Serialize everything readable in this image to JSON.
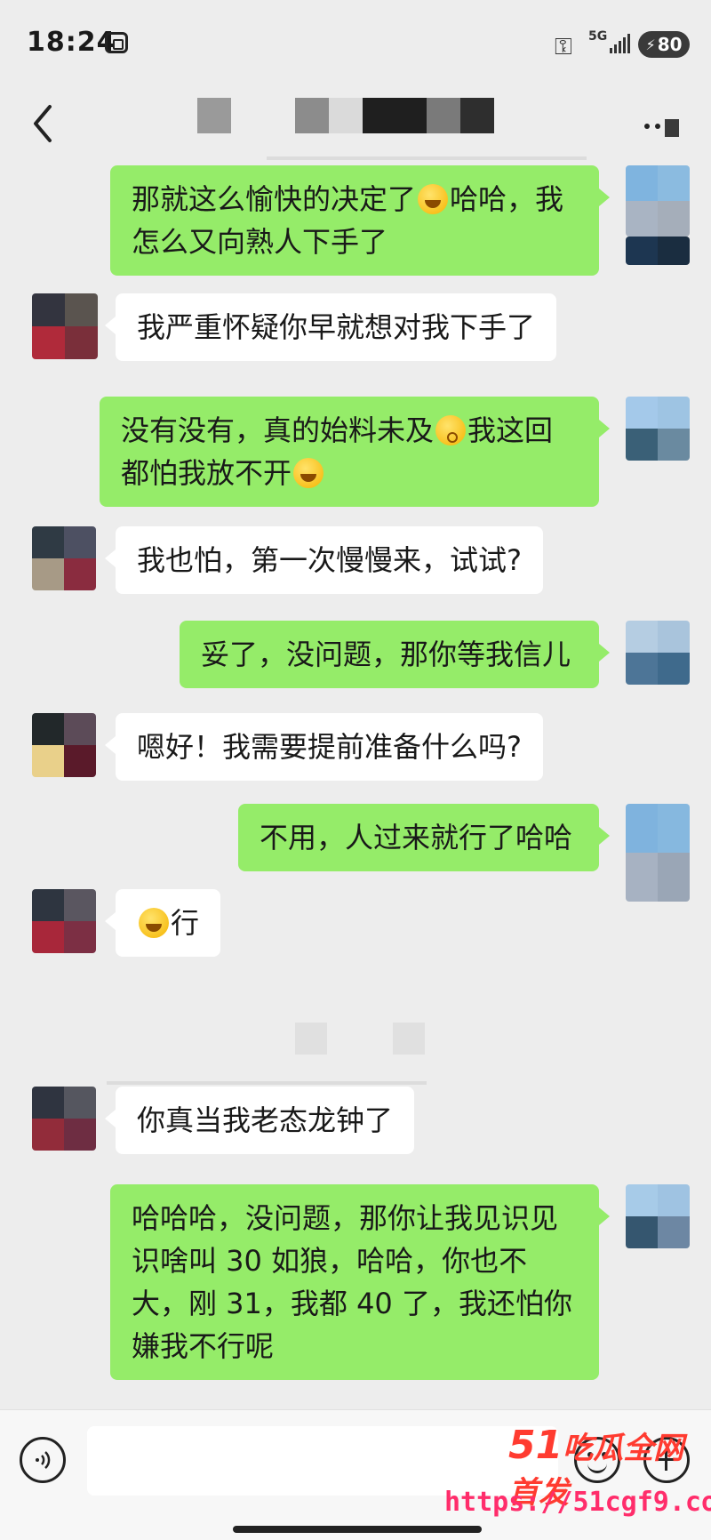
{
  "status_bar": {
    "time": "18:24",
    "network": "5G",
    "battery": "80"
  },
  "nav": {
    "back_icon": "chevron-left-icon",
    "more_icon": "more-dots-icon"
  },
  "messages": [
    {
      "from": "me",
      "parts": [
        "那就这么愉快的决定了",
        "哈哈，我怎么又向熟人下手了"
      ],
      "emoji": "cry-laugh"
    },
    {
      "from": "them",
      "text": "我严重怀疑你早就想对我下手了"
    },
    {
      "from": "me",
      "parts": [
        "没有没有，真的始料未及",
        "我这回都怕我放不开"
      ],
      "emojis": [
        "kiss-face",
        "cry-laugh"
      ]
    },
    {
      "from": "them",
      "text": "我也怕，第一次慢慢来，试试?"
    },
    {
      "from": "me",
      "text": "妥了，没问题，那你等我信儿"
    },
    {
      "from": "them",
      "text": "嗯好！我需要提前准备什么吗?"
    },
    {
      "from": "me",
      "text": "不用，人过来就行了哈哈"
    },
    {
      "from": "them",
      "text": "行",
      "emoji": "cry-laugh"
    },
    {
      "from": "them",
      "text": "你真当我老态龙钟了"
    },
    {
      "from": "me",
      "text": "哈哈哈，没问题，那你让我见识见识啥叫 30 如狼，哈哈，你也不大，刚 31，我都 40 了，我还怕你嫌我不行呢"
    }
  ],
  "input_bar": {
    "voice_icon": "voice-icon",
    "emoji_icon": "emoji-icon",
    "add_icon": "plus-icon"
  },
  "watermark": {
    "brand_num": "51",
    "brand_text": "吃瓜全网首发",
    "url": "https://51cgf9.com"
  },
  "colors": {
    "my_bubble": "#95ec69",
    "their_bubble": "#ffffff",
    "background": "#ededed"
  }
}
